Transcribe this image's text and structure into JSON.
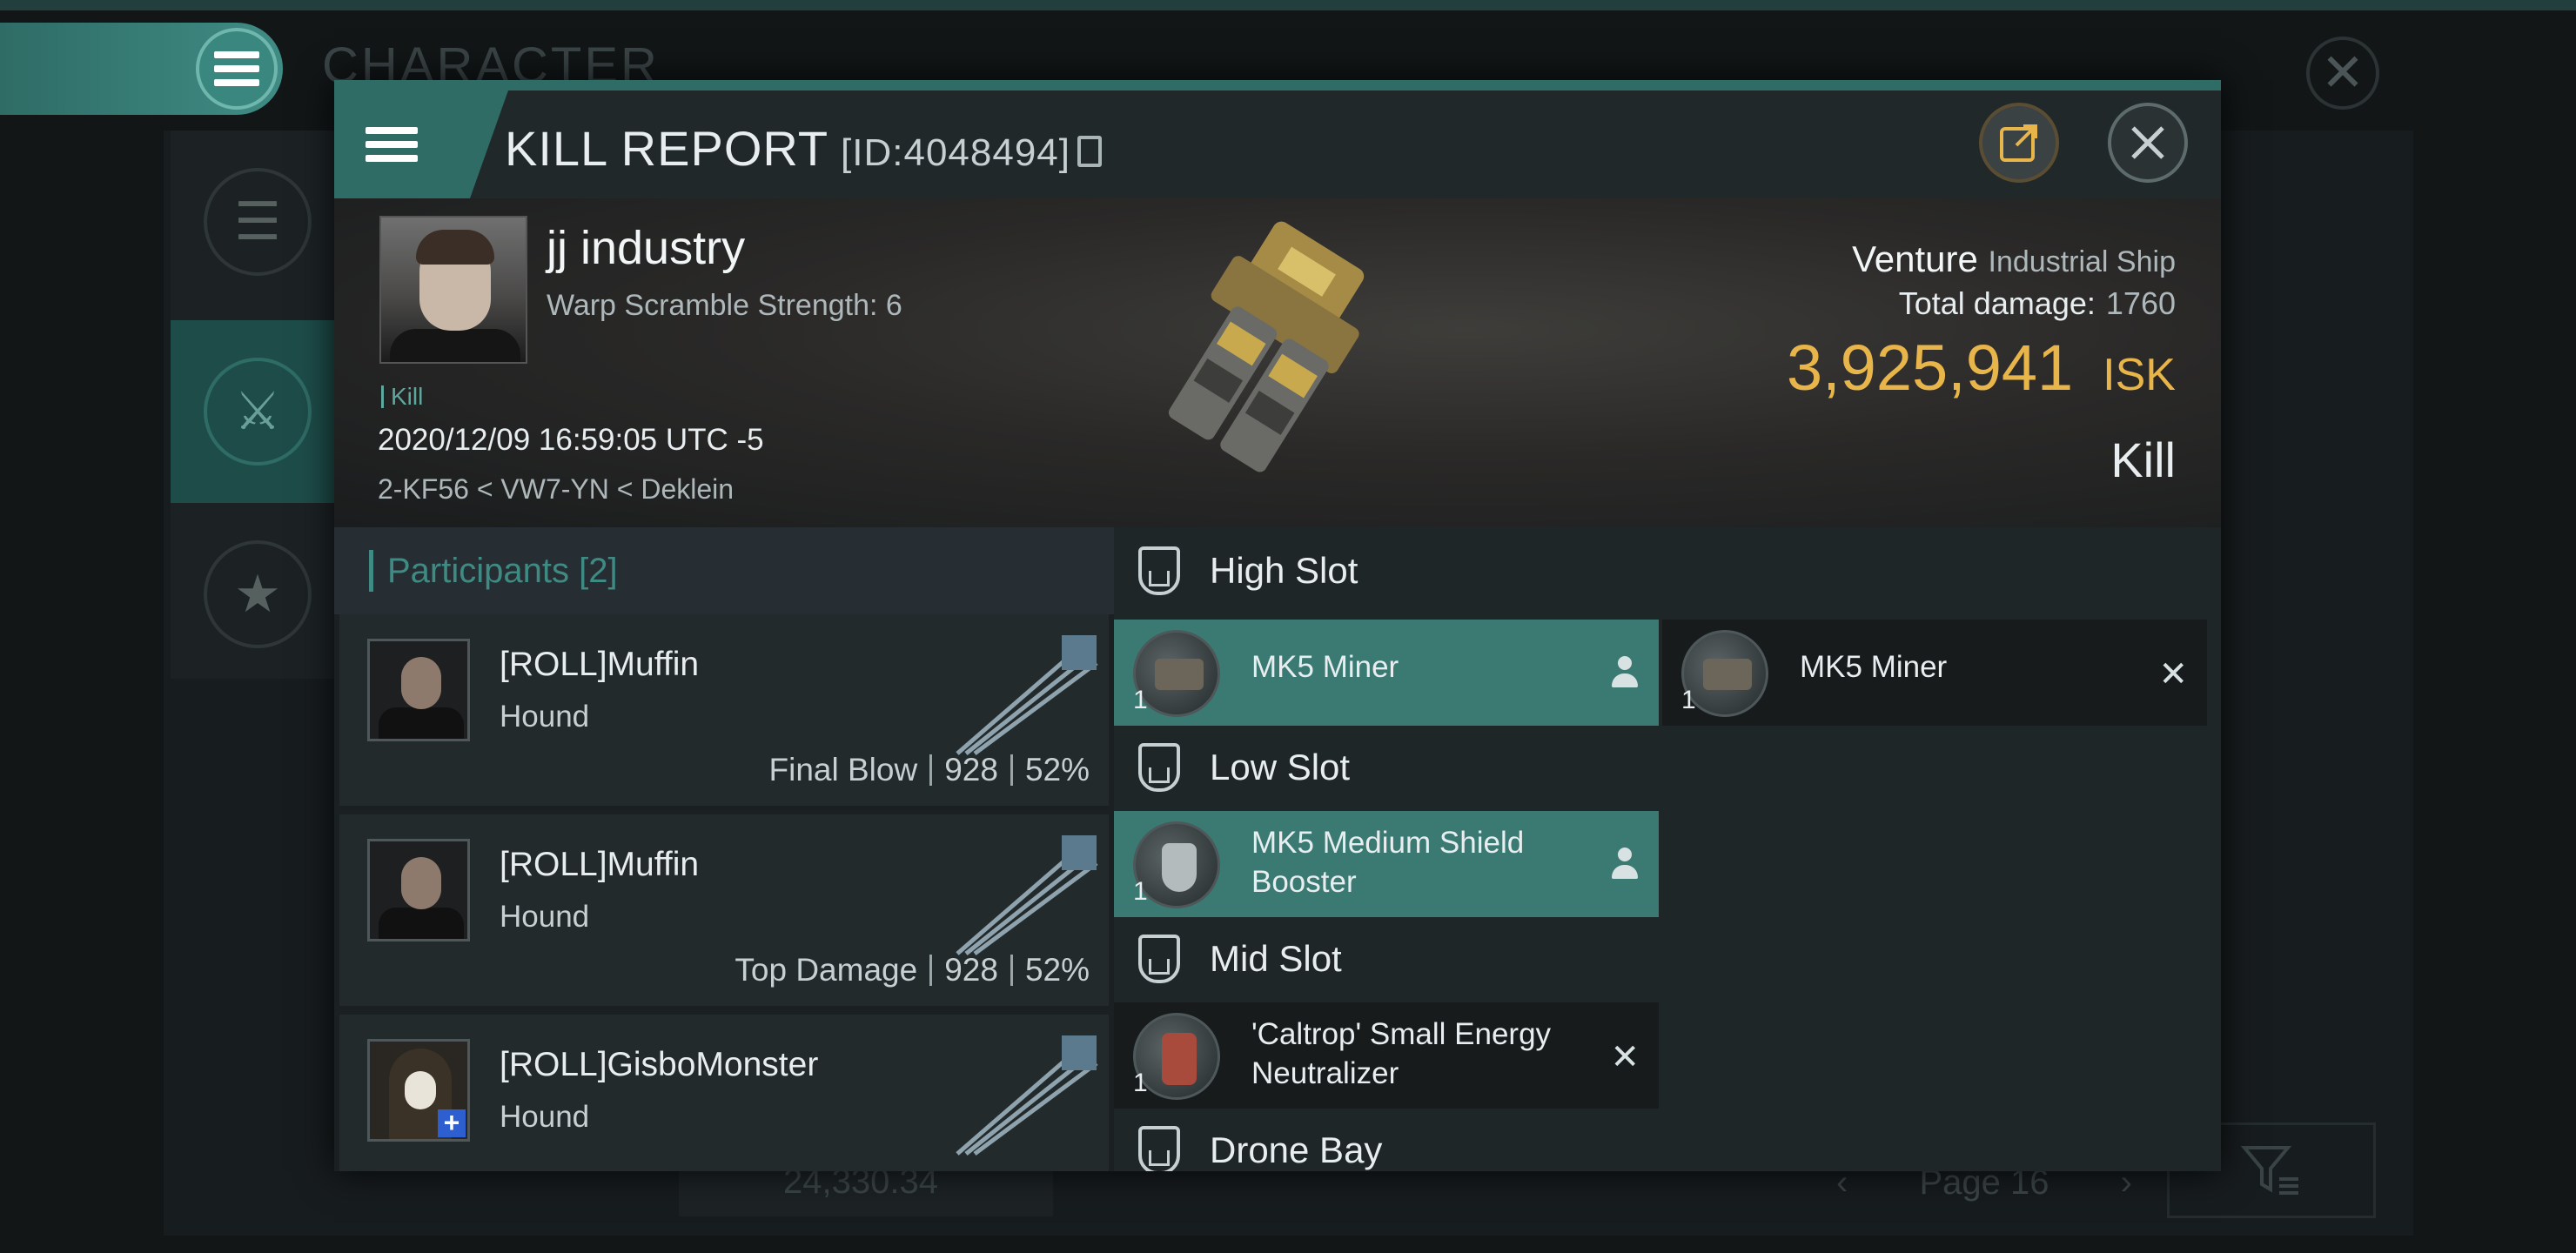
{
  "background": {
    "screen_title": "CHARACTER",
    "bottom_value": "24,330.34",
    "page_label": "Page 16"
  },
  "dialog": {
    "title": "KILL REPORT",
    "id_label": "[ID:4048494]"
  },
  "victim": {
    "name": "jj industry",
    "warp_scramble": "Warp Scramble Strength: 6",
    "kill_tag": "Kill",
    "datetime": "2020/12/09 16:59:05 UTC -5",
    "location": "2-KF56 < VW7-YN < Deklein",
    "ship_name": "Venture",
    "ship_class": "Industrial Ship",
    "total_damage_label": "Total damage:",
    "total_damage_value": "1760",
    "isk_value": "3,925,941",
    "isk_unit": "ISK",
    "result": "Kill"
  },
  "participants": {
    "header": "Participants [2]",
    "rows": [
      {
        "name": "[ROLL]Muffin",
        "ship": "Hound",
        "tag": "Final Blow",
        "damage": "928",
        "percent": "52%"
      },
      {
        "name": "[ROLL]Muffin",
        "ship": "Hound",
        "tag": "Top Damage",
        "damage": "928",
        "percent": "52%"
      },
      {
        "name": "[ROLL]GisboMonster",
        "ship": "Hound"
      }
    ]
  },
  "fitting": {
    "high_slot": "High Slot",
    "low_slot": "Low Slot",
    "mid_slot": "Mid Slot",
    "drone_bay": "Drone Bay",
    "modules": [
      {
        "name": "MK5 Miner",
        "qty": "1",
        "state": "dropped"
      },
      {
        "name": "MK5 Miner",
        "qty": "1",
        "state": "destroyed"
      },
      {
        "name": "MK5 Medium Shield Booster",
        "qty": "1",
        "state": "dropped"
      },
      {
        "name": "'Caltrop' Small Energy Neutralizer",
        "qty": "1",
        "state": "destroyed"
      }
    ],
    "destroyed_mark": "✕"
  },
  "colors": {
    "accent": "#2f6c66",
    "isk_gold": "#e8b54a",
    "dropped_bg": "#3a7a73",
    "participants_header": "#3f8b84"
  }
}
